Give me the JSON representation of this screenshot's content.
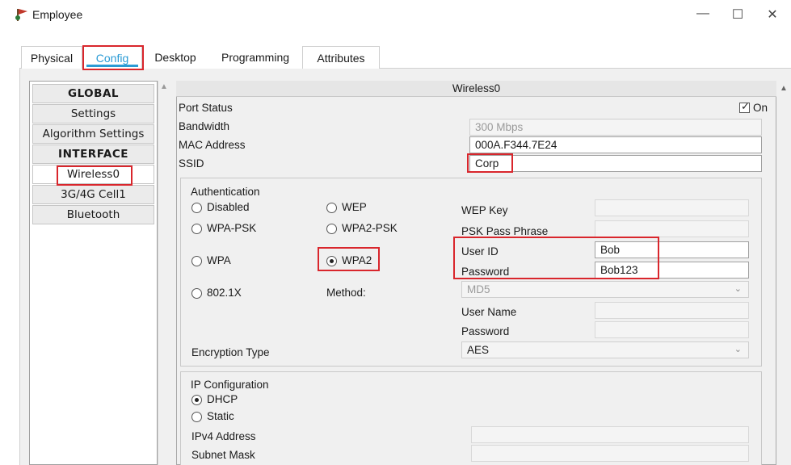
{
  "window": {
    "title": "Employee"
  },
  "tabs": [
    {
      "label": "Physical"
    },
    {
      "label": "Config"
    },
    {
      "label": "Desktop"
    },
    {
      "label": "Programming"
    },
    {
      "label": "Attributes"
    }
  ],
  "sidebar": {
    "items": [
      {
        "label": "GLOBAL"
      },
      {
        "label": "Settings"
      },
      {
        "label": "Algorithm Settings"
      },
      {
        "label": "INTERFACE"
      },
      {
        "label": "Wireless0"
      },
      {
        "label": "3G/4G Cell1"
      },
      {
        "label": "Bluetooth"
      }
    ]
  },
  "panel": {
    "title": "Wireless0",
    "port_status": {
      "label": "Port Status",
      "checkbox_label": "On",
      "checked": true
    },
    "bandwidth": {
      "label": "Bandwidth",
      "value": "300 Mbps"
    },
    "mac": {
      "label": "MAC Address",
      "value": "000A.F344.7E24"
    },
    "ssid": {
      "label": "SSID",
      "value": "Corp"
    },
    "auth": {
      "title": "Authentication",
      "options": {
        "disabled": "Disabled",
        "wep": "WEP",
        "wpa_psk": "WPA-PSK",
        "wpa2_psk": "WPA2-PSK",
        "wpa": "WPA",
        "wpa2": "WPA2",
        "dot1x": "802.1X"
      },
      "selected": "WPA2",
      "method_label": "Method:",
      "wep_key_label": "WEP Key",
      "psk_label": "PSK Pass Phrase",
      "user_id_label": "User ID",
      "user_id_value": "Bob",
      "password_label": "Password",
      "password_value": "Bob123",
      "method_value": "MD5",
      "user_name_label": "User Name",
      "password2_label": "Password"
    },
    "encryption": {
      "label": "Encryption Type",
      "value": "AES"
    },
    "ip": {
      "title": "IP Configuration",
      "dhcp": "DHCP",
      "static": "Static",
      "selected": "DHCP",
      "ipv4_label": "IPv4 Address",
      "subnet_label": "Subnet Mask"
    }
  },
  "colors": {
    "accent": "#2a9bd5",
    "highlight": "#d9262c"
  }
}
